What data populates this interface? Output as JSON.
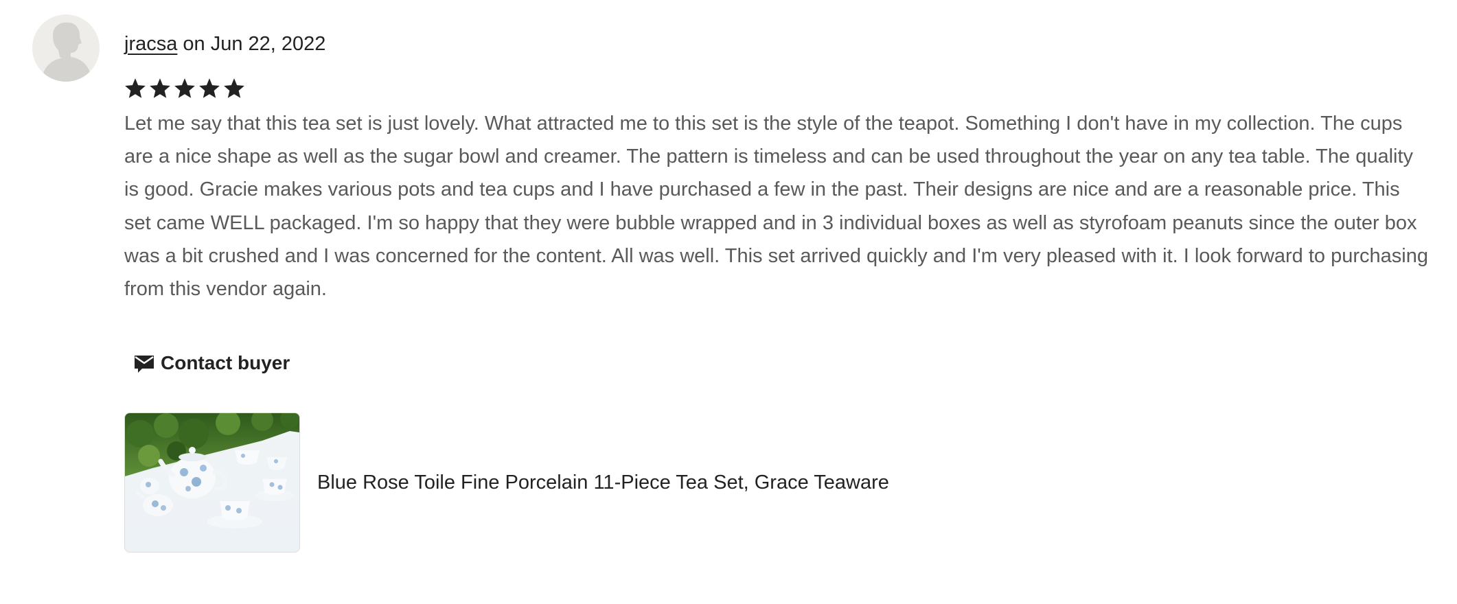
{
  "review": {
    "username": "jracsa",
    "date_text": " on Jun 22, 2022",
    "rating": 5,
    "rating_max": 5,
    "text": "Let me say that this tea set is just lovely. What attracted me to this set is the style of the teapot. Something I don't have in my collection. The cups are a nice shape as well as the sugar bowl and creamer. The pattern is timeless and can be used throughout the year on any tea table. The quality is good. Gracie makes various pots and tea cups and I have purchased a few in the past. Their designs are nice and are a reasonable price. This set came WELL packaged. I'm so happy that they were bubble wrapped and in 3 individual boxes as well as styrofoam peanuts since the outer box was a bit crushed and I was concerned for the content. All was well. This set arrived quickly and I'm very pleased with it. I look forward to purchasing from this vendor again."
  },
  "contact": {
    "label": "Contact buyer",
    "icon": "mail-icon"
  },
  "product": {
    "title": "Blue Rose Toile Fine Porcelain 11-Piece Tea Set, Grace Teaware"
  },
  "colors": {
    "text_primary": "#222222",
    "text_body": "#595959",
    "star": "#222222",
    "avatar_bg": "#eeede9",
    "avatar_silhouette": "#d4d3cf"
  }
}
